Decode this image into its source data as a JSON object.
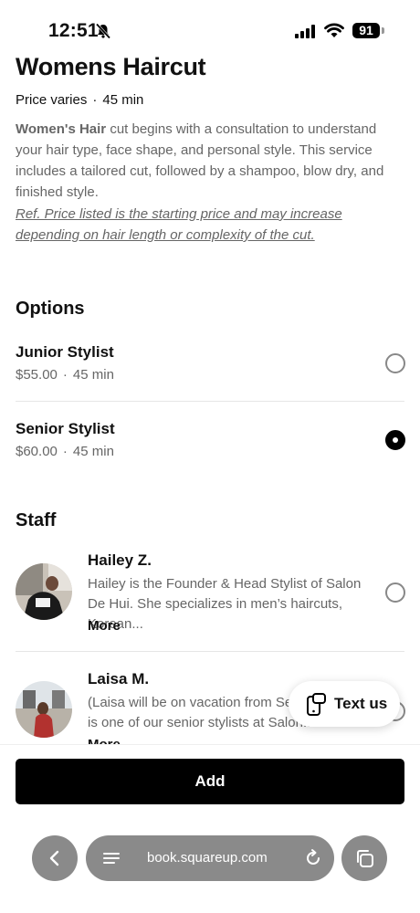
{
  "status": {
    "time": "12:51",
    "battery": "91"
  },
  "service": {
    "title": "Womens Haircut",
    "price": "Price varies",
    "duration": "45 min",
    "desc_bold": "Women's Hair",
    "desc_rest": " cut begins with a consultation to understand your hair type, face shape, and personal style. This service includes a tailored cut, followed by a shampoo, blow dry, and finished style.",
    "ref": "Ref. Price listed is the starting price and may increase depending on hair length or complexity of the cut."
  },
  "options": {
    "title": "Options",
    "items": [
      {
        "name": "Junior Stylist",
        "price": "$55.00",
        "duration": "45 min",
        "selected": false
      },
      {
        "name": "Senior Stylist",
        "price": "$60.00",
        "duration": "45 min",
        "selected": true
      }
    ]
  },
  "staff": {
    "title": "Staff",
    "more_label": "More",
    "items": [
      {
        "name": "Hailey Z.",
        "bio": "Hailey is the Founder & Head Stylist of Salon De Hui. She specializes in men’s haircuts, Korean..."
      },
      {
        "name": "Laisa M.",
        "bio": "(Laisa will be on vacation from Sep 25th) Laisa is one of our senior stylists at Salon..."
      }
    ]
  },
  "chat": {
    "label": "Text us"
  },
  "footer": {
    "add_label": "Add",
    "url": "book.squareup.com"
  },
  "colors": {
    "accent": "#000000",
    "muted_text": "#666666",
    "toolbar": "#8a8a8a"
  }
}
